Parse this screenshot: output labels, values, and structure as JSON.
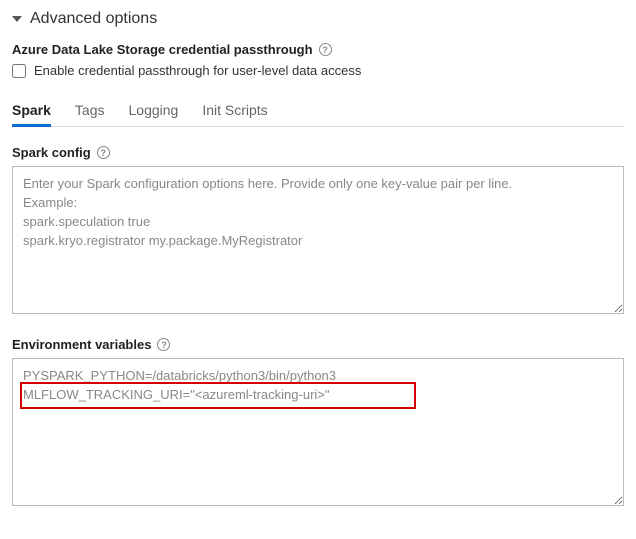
{
  "header": {
    "title": "Advanced options"
  },
  "passthrough": {
    "label": "Azure Data Lake Storage credential passthrough",
    "checkbox_label": "Enable credential passthrough for user-level data access"
  },
  "tabs": {
    "spark": "Spark",
    "tags": "Tags",
    "logging": "Logging",
    "init_scripts": "Init Scripts"
  },
  "spark_config": {
    "label": "Spark config",
    "placeholder": "Enter your Spark configuration options here. Provide only one key-value pair per line.\nExample:\nspark.speculation true\nspark.kryo.registrator my.package.MyRegistrator",
    "value": ""
  },
  "env_vars": {
    "label": "Environment variables",
    "value": "PYSPARK_PYTHON=/databricks/python3/bin/python3\nMLFLOW_TRACKING_URI=\"<azureml-tracking-uri>\""
  }
}
